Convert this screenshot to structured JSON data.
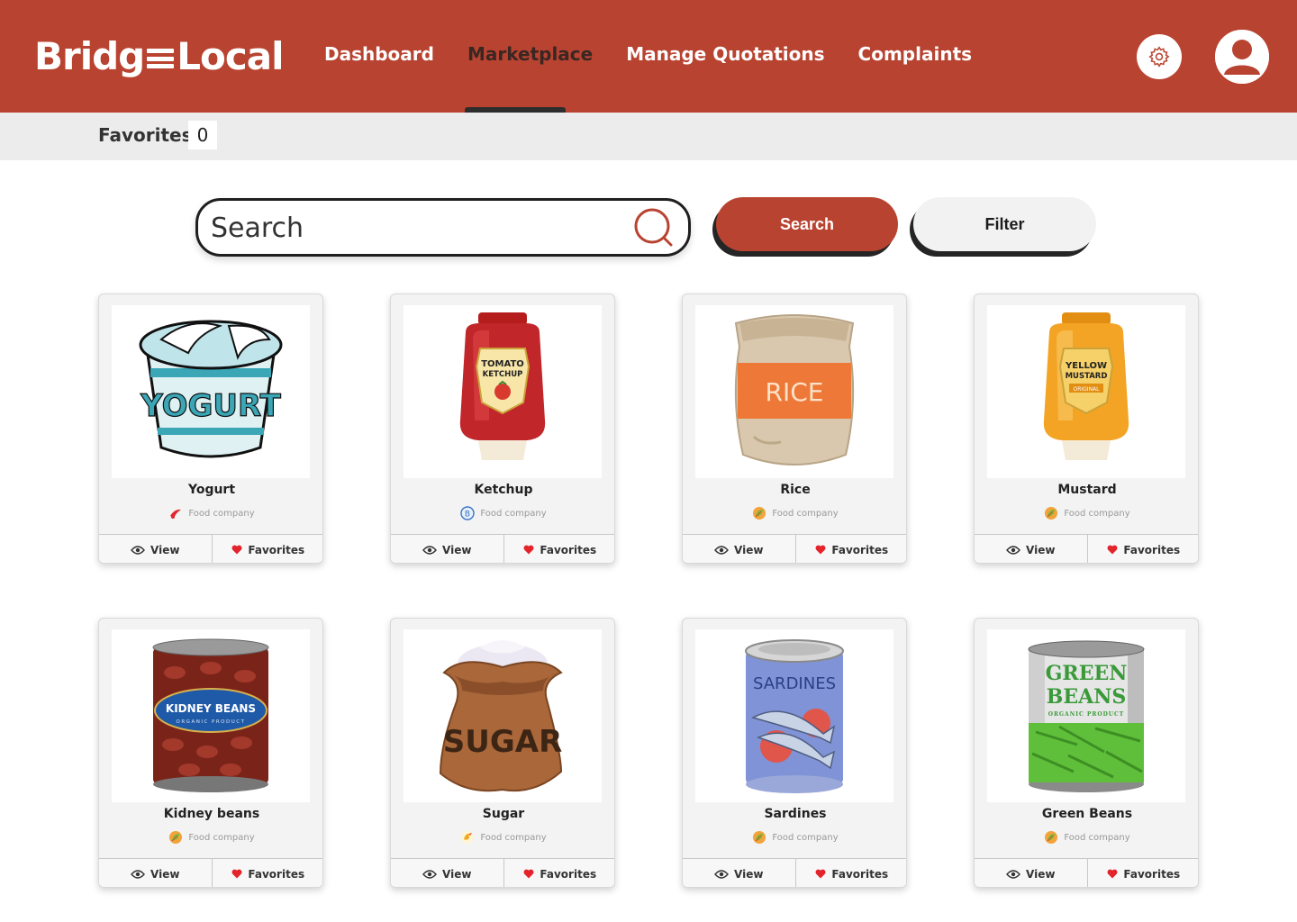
{
  "app": {
    "logo_left": "Bridg",
    "logo_right": "Local"
  },
  "nav": {
    "items": [
      {
        "label": "Dashboard",
        "active": false
      },
      {
        "label": "Marketplace",
        "active": true
      },
      {
        "label": "Manage Quotations",
        "active": false
      },
      {
        "label": "Complaints",
        "active": false
      }
    ]
  },
  "header_icons": {
    "settings": "gear-icon",
    "profile": "user-icon"
  },
  "favorites": {
    "label": "Favorites",
    "count": "0"
  },
  "search": {
    "placeholder": "Search",
    "button_label": "Search",
    "filter_label": "Filter"
  },
  "colors": {
    "brand": "#b94331",
    "favorite_heart": "#e3242b"
  },
  "products": [
    {
      "name": "Yogurt",
      "company": "Food company",
      "company_logo": "brand-swoosh-icon"
    },
    {
      "name": "Ketchup",
      "company": "Food company",
      "company_logo": "brand-circle-icon"
    },
    {
      "name": "Rice",
      "company": "Food company",
      "company_logo": "brand-leaf-icon"
    },
    {
      "name": "Mustard",
      "company": "Food company",
      "company_logo": "brand-leaf-icon"
    },
    {
      "name": "Kidney beans",
      "company": "Food company",
      "company_logo": "brand-leaf-icon"
    },
    {
      "name": "Sugar",
      "company": "Food company",
      "company_logo": "brand-bird-icon"
    },
    {
      "name": "Sardines",
      "company": "Food company",
      "company_logo": "brand-leaf-icon"
    },
    {
      "name": "Green Beans",
      "company": "Food company",
      "company_logo": "brand-leaf-icon"
    }
  ],
  "product_labels": {
    "yogurt": "YOGURT",
    "ketchup": [
      "TOMATO",
      "KETCHUP"
    ],
    "rice": "RICE",
    "mustard": [
      "YELLOW",
      "MUSTARD",
      "ORIGINAL"
    ],
    "kidney_beans": [
      "KIDNEY BEANS",
      "ORGANIC PRODUCT"
    ],
    "sugar": "SUGAR",
    "sardines": "SARDINES",
    "green_beans": [
      "GREEN",
      "BEANS",
      "ORGANIC PRODUCT"
    ]
  },
  "card_actions": {
    "view_label": "View",
    "favorites_label": "Favorites"
  }
}
